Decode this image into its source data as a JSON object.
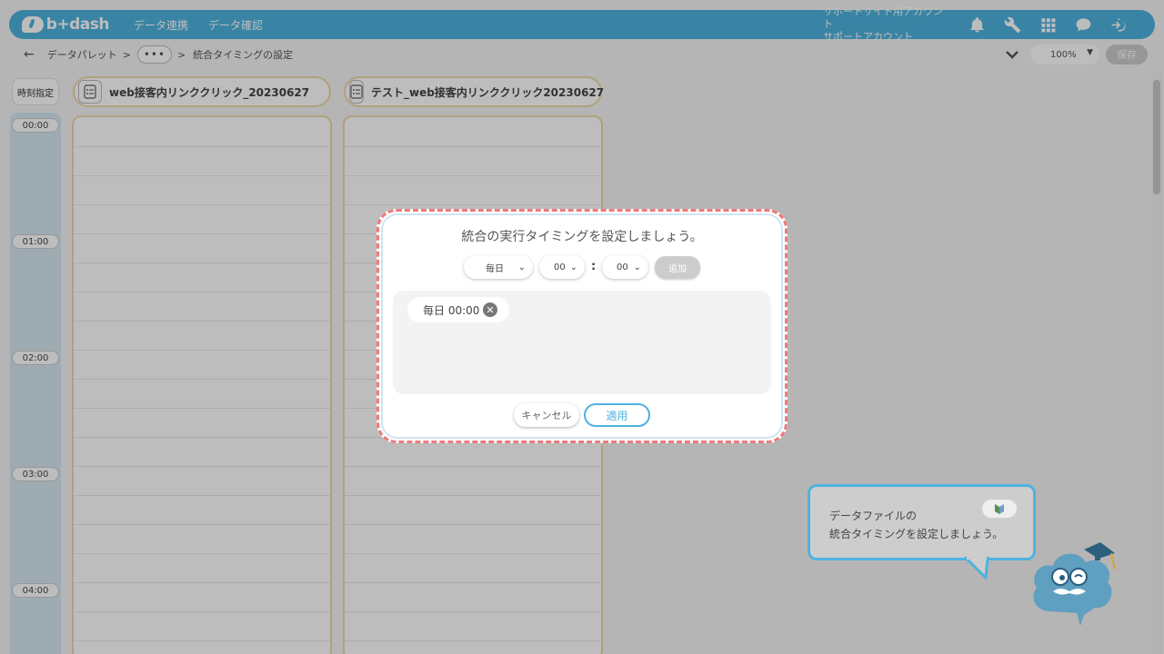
{
  "header": {
    "logo_text": "b+dash",
    "nav": [
      "データ連携",
      "データ確認"
    ],
    "account_line1": "サポートサイト用アカウント",
    "account_line2": "サポートアカウント",
    "icons": [
      "bell-icon",
      "wrench-icon",
      "grid-icon",
      "chat-icon",
      "logout-icon"
    ]
  },
  "subbar": {
    "back_icon": "arrow-left-icon",
    "crumb_root": "データパレット",
    "separator": ">",
    "more_label": "•••",
    "crumb_current": "統合タイミングの設定",
    "zoom": "100%",
    "save_label": "保存"
  },
  "timeline": {
    "header_label": "時刻指定",
    "times": [
      "00:00",
      "01:00",
      "02:00",
      "03:00",
      "04:00"
    ]
  },
  "lanes": [
    {
      "title": "web接客内リンククリック_20230627",
      "icon": "file-list-icon"
    },
    {
      "title": "テスト_web接客内リンククリック20230627",
      "icon": "file-list-icon"
    }
  ],
  "modal": {
    "title": "統合の実行タイミングを設定しましょう。",
    "frequency": "毎日",
    "hour": "00",
    "colon": ":",
    "minute": "00",
    "add_label": "追加",
    "schedules": [
      "毎日 00:00"
    ],
    "remove_icon": "close-circle-icon",
    "cancel_label": "キャンセル",
    "apply_label": "適用"
  },
  "tooltip": {
    "line1": "データファイルの",
    "line2": "統合タイミングを設定しましょう。",
    "badge_icon": "beginner-mark-icon"
  },
  "colors": {
    "brand": "#4eb3de",
    "modal_dashed_border": "#ef7a7a",
    "lane_border": "#ecd9a6",
    "time_column": "#d6e7f2"
  }
}
